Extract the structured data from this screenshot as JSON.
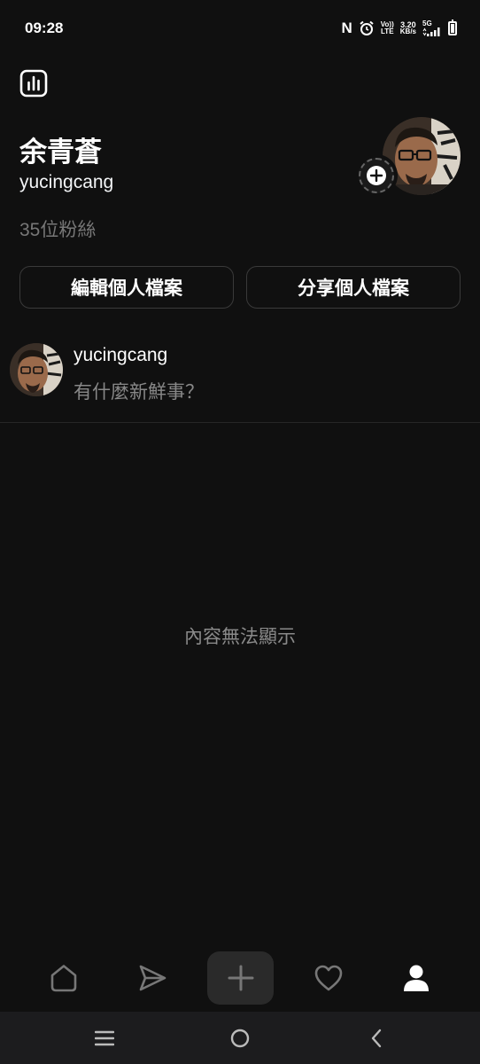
{
  "status_bar": {
    "time": "09:28",
    "nfc_label": "N",
    "volte_top": "Vo))",
    "volte_bottom": "LTE",
    "speed_value": "3.20",
    "speed_unit": "KB/s",
    "network": "5G",
    "battery_level": 1.0
  },
  "header": {
    "insights_icon": "bar-chart-icon"
  },
  "profile": {
    "display_name": "余青蒼",
    "username": "yucingcang",
    "followers": "35位粉絲",
    "avatar_icon": "avatar",
    "add_story_icon": "plus-icon"
  },
  "actions": {
    "edit_label": "編輯個人檔案",
    "share_label": "分享個人檔案"
  },
  "composer": {
    "username": "yucingcang",
    "prompt": "有什麼新鮮事？"
  },
  "feed": {
    "empty_message": "內容無法顯示"
  },
  "bottom_nav": {
    "items": [
      {
        "icon": "home-icon",
        "active": false
      },
      {
        "icon": "send-icon",
        "active": false
      },
      {
        "icon": "plus-icon",
        "active": false
      },
      {
        "icon": "heart-icon",
        "active": false
      },
      {
        "icon": "profile-icon",
        "active": true
      }
    ]
  },
  "system_nav": {
    "items": [
      "menu-icon",
      "home-circle-icon",
      "back-icon"
    ]
  },
  "colors": {
    "background": "#101010",
    "text_primary": "#f3f5f7",
    "text_secondary": "#777777",
    "border": "#3a3a3a",
    "create_button_bg": "#2a2a2a"
  }
}
